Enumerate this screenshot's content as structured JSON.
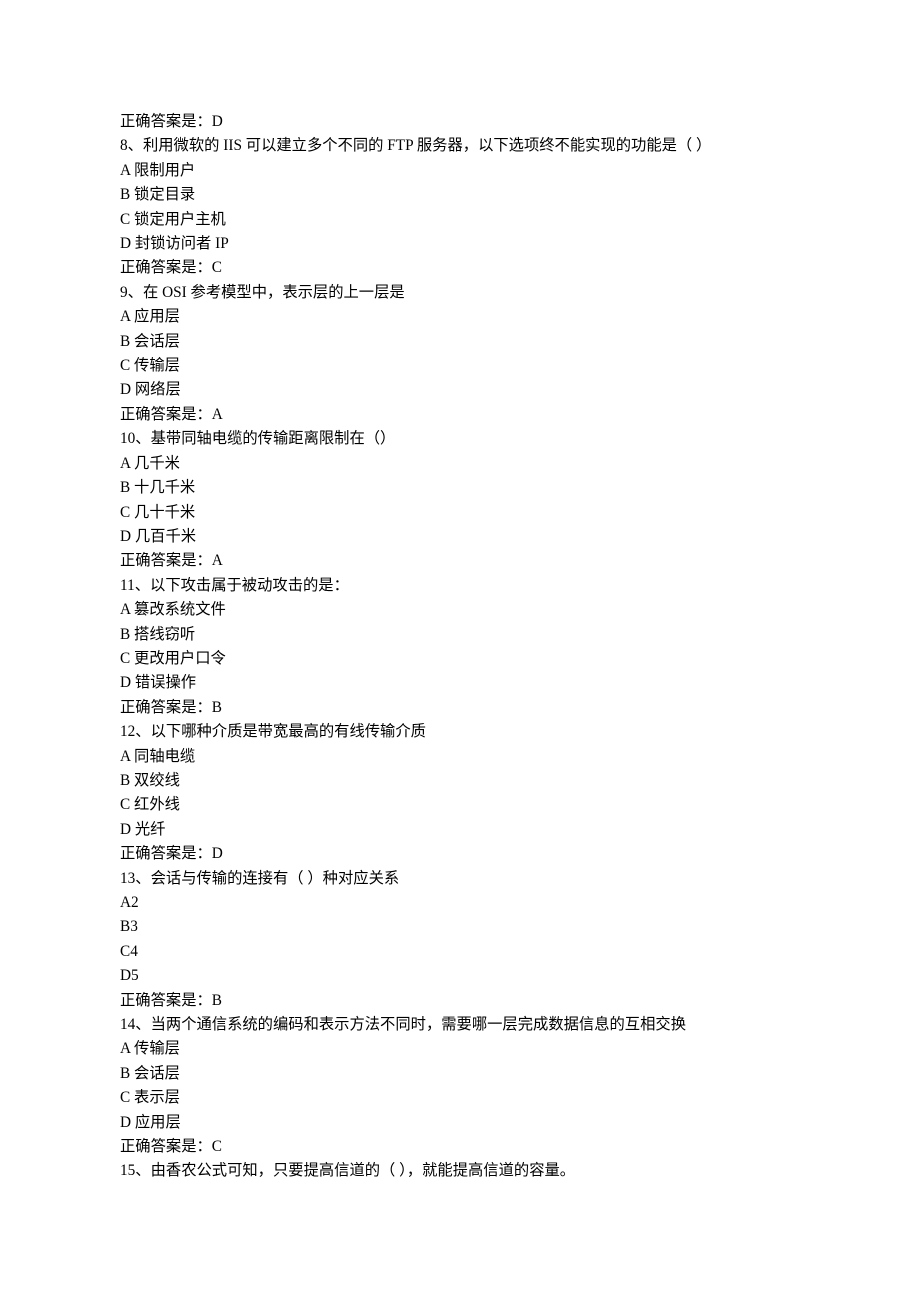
{
  "lines": [
    "正确答案是：D",
    "8、利用微软的 IIS 可以建立多个不同的 FTP 服务器，以下选项终不能实现的功能是（ ）",
    "A 限制用户",
    "B 锁定目录",
    "C 锁定用户主机",
    "D 封锁访问者 IP",
    "正确答案是：C",
    "9、在 OSI 参考模型中，表示层的上一层是",
    "A 应用层",
    "B 会话层",
    "C 传输层",
    "D 网络层",
    "正确答案是：A",
    "10、基带同轴电缆的传输距离限制在（）",
    "A 几千米",
    "B 十几千米",
    "C 几十千米",
    "D 几百千米",
    "正确答案是：A",
    "11、以下攻击属于被动攻击的是：",
    "A 篡改系统文件",
    "B 搭线窃听",
    "C 更改用户口令",
    "D 错误操作",
    "正确答案是：B",
    "12、以下哪种介质是带宽最高的有线传输介质",
    "A 同轴电缆",
    "B 双绞线",
    "C 红外线",
    "D 光纤",
    "正确答案是：D",
    "13、会话与传输的连接有（ ）种对应关系",
    "A2",
    "B3",
    "C4",
    "D5",
    "正确答案是：B",
    "14、当两个通信系统的编码和表示方法不同时，需要哪一层完成数据信息的互相交换",
    "A 传输层",
    "B 会话层",
    "C 表示层",
    "D 应用层",
    "正确答案是：C",
    "15、由香农公式可知，只要提高信道的（ ），就能提高信道的容量。"
  ]
}
